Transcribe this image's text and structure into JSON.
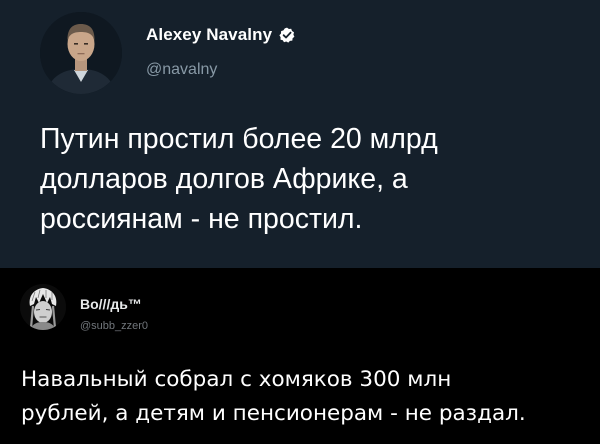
{
  "colors": {
    "tweet1_background": "#15202b",
    "page_background": "#000000",
    "text_primary": "#ffffff",
    "text_secondary": "#8899a6",
    "verified_badge": "#ffffff"
  },
  "tweet1": {
    "author": {
      "display_name": "Alexey Navalny",
      "handle": "@navalny",
      "verified": true,
      "avatar_icon": "avatar-photo-icon",
      "verified_icon": "verified-badge-icon"
    },
    "text_lines": [
      "Путин простил более 20 млрд",
      "долларов долгов Африке, а",
      "россиянам - не простил."
    ]
  },
  "tweet2": {
    "author": {
      "display_name": "Во///дь™",
      "handle": "@subb_zzer0",
      "avatar_icon": "avatar-sketch-icon"
    },
    "text_lines": [
      "Навальный собрал с хомяков 300 млн",
      "рублей, а детям и пенсионерам - не раздал."
    ]
  }
}
